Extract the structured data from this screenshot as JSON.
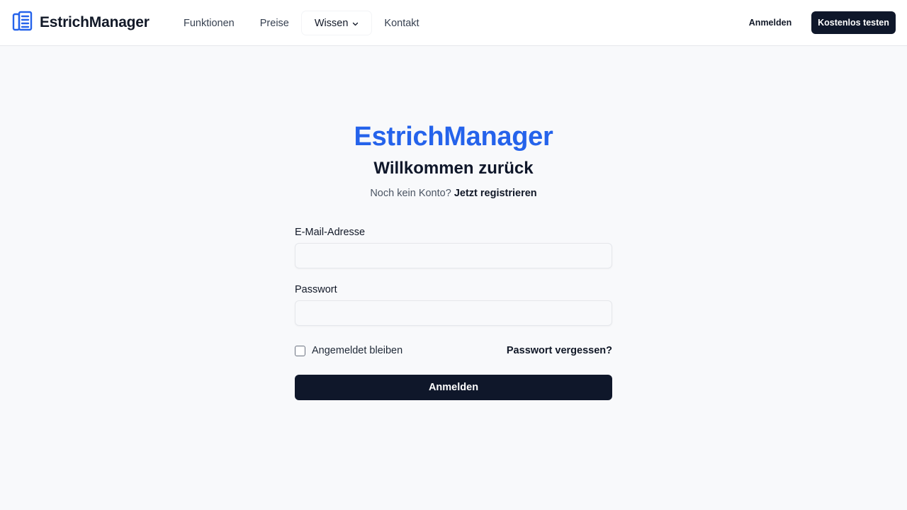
{
  "header": {
    "brand": "EstrichManager",
    "brand_icon": "building-icon",
    "nav": [
      {
        "label": "Funktionen"
      },
      {
        "label": "Preise"
      },
      {
        "label": "Wissen",
        "has_dropdown": true
      },
      {
        "label": "Kontakt"
      }
    ],
    "login_label": "Anmelden",
    "cta_label": "Kostenlos testen"
  },
  "main": {
    "brand": "EstrichManager",
    "welcome": "Willkommen zurück",
    "no_account": "Noch kein Konto?",
    "register_link": "Jetzt registrieren",
    "email_label": "E-Mail-Adresse",
    "email_value": "",
    "password_label": "Passwort",
    "password_value": "",
    "remember_label": "Angemeldet bleiben",
    "remember_checked": false,
    "forgot_label": "Passwort vergessen?",
    "submit_label": "Anmelden"
  },
  "colors": {
    "accent": "#2563eb",
    "primary_button": "#0f172a",
    "background": "#f8f9fb"
  }
}
